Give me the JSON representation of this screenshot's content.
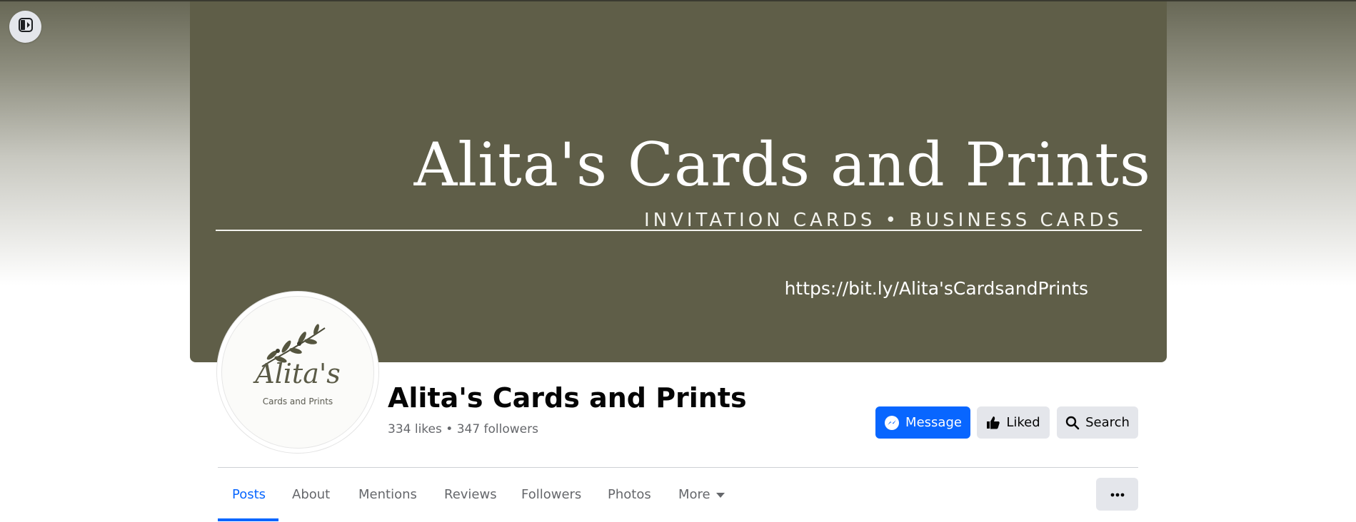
{
  "cover": {
    "title": "Alita's Cards and Prints",
    "subtitle": "INVITATION CARDS • BUSINESS CARDS",
    "url": "https://bit.ly/Alita'sCardsandPrints"
  },
  "avatar": {
    "script": "Alita's",
    "caption": "Cards and Prints"
  },
  "page": {
    "name": "Alita's Cards and Prints",
    "stats": "334 likes • 347 followers"
  },
  "actions": {
    "message_label": "Message",
    "liked_label": "Liked",
    "search_label": "Search"
  },
  "tabs": [
    {
      "label": "Posts"
    },
    {
      "label": "About"
    },
    {
      "label": "Mentions"
    },
    {
      "label": "Reviews"
    },
    {
      "label": "Followers"
    },
    {
      "label": "Photos"
    },
    {
      "label": "More"
    }
  ],
  "colors": {
    "accent": "#0866ff",
    "cover_bg": "#5f5e48",
    "button_gray": "#e4e6eb"
  },
  "icons": [
    "sidebar-toggle-icon",
    "messenger-icon",
    "thumbs-up-icon",
    "search-icon",
    "chevron-down-icon",
    "more-options-icon"
  ]
}
